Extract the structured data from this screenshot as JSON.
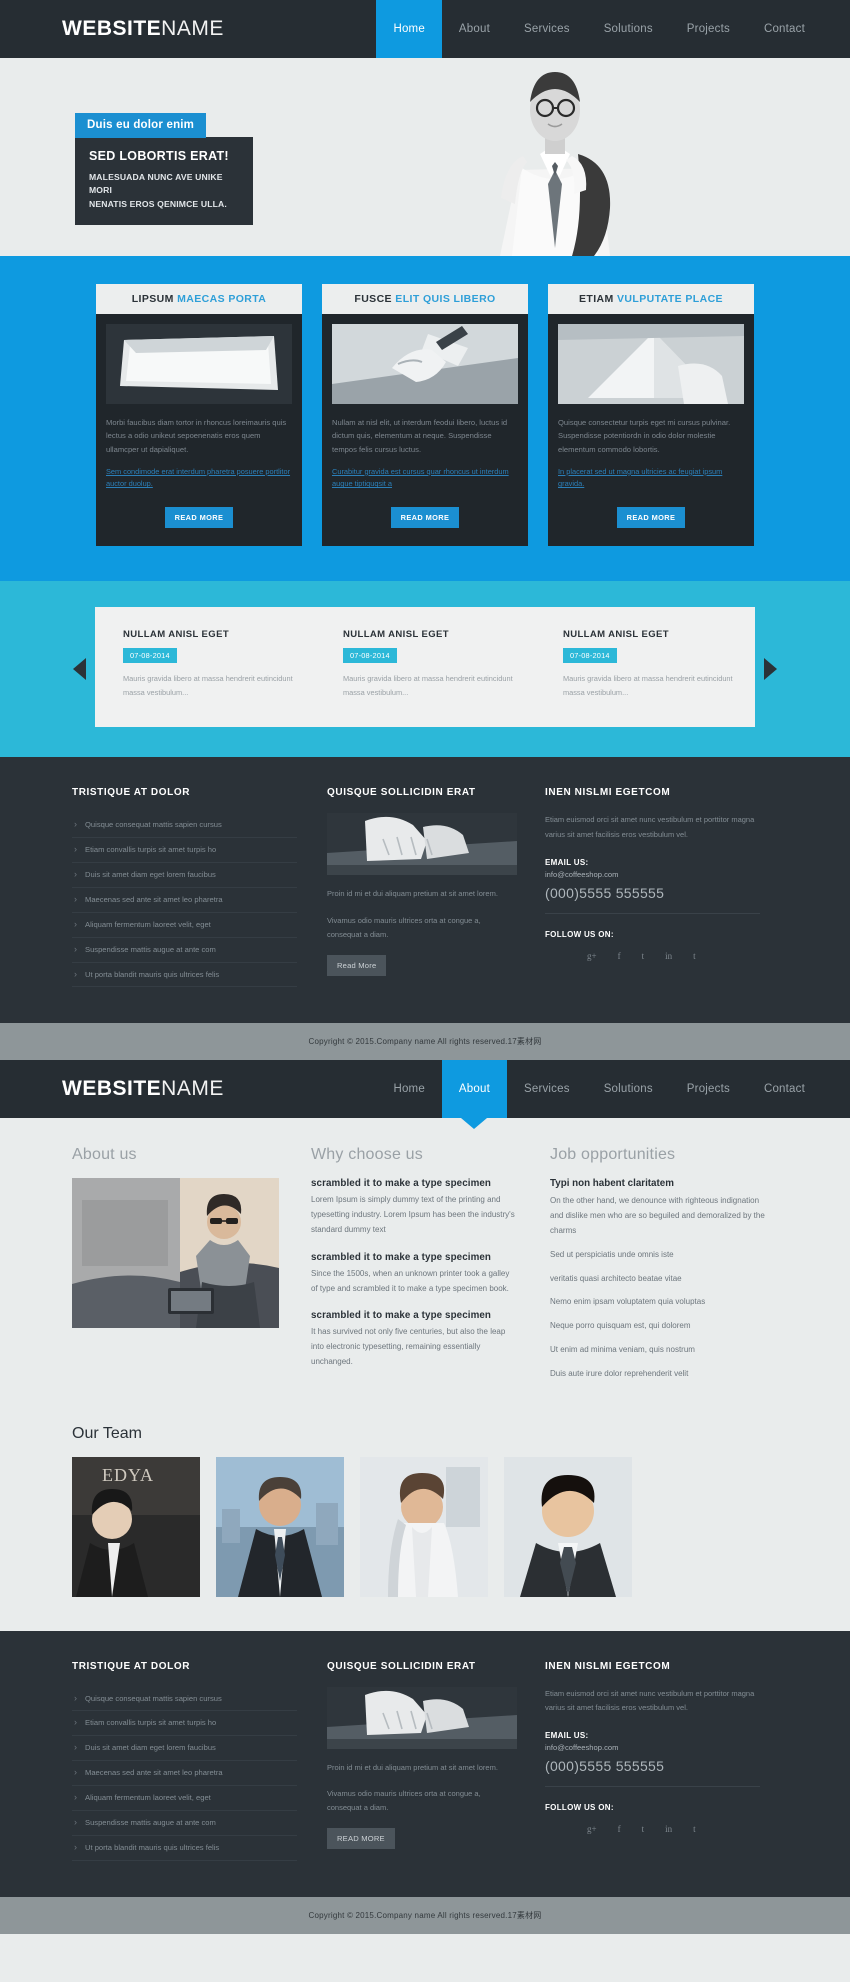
{
  "brand": {
    "bold": "WEBSITE",
    "light": "NAME"
  },
  "colors": {
    "accent": "#0e9ae0",
    "dark": "#2b3238",
    "teal": "#2cb8d8",
    "grey": "#8e9699"
  },
  "nav_home": [
    {
      "label": "Home",
      "active": true
    },
    {
      "label": "About",
      "active": false
    },
    {
      "label": "Services",
      "active": false
    },
    {
      "label": "Solutions",
      "active": false
    },
    {
      "label": "Projects",
      "active": false
    },
    {
      "label": "Contact",
      "active": false
    }
  ],
  "nav_about": [
    {
      "label": "Home",
      "active": false
    },
    {
      "label": "About",
      "active": true
    },
    {
      "label": "Services",
      "active": false
    },
    {
      "label": "Solutions",
      "active": false
    },
    {
      "label": "Projects",
      "active": false
    },
    {
      "label": "Contact",
      "active": false
    }
  ],
  "hero": {
    "tag": "Duis eu dolor enim",
    "title": "SED LOBORTIS ERAT!",
    "line1": "MALESUADA NUNC AVE UNIKE MORI",
    "line2": "NENATIS EROS QENIMCE ULLA."
  },
  "services": [
    {
      "head_dark": "LIPSUM",
      "head_blue": "MAECAS PORTA",
      "text": "Morbi faucibus diam tortor in rhoncus loreimauris quis lectus a odio unikeut sepoenenatis eros quem ullamcper ut dapialiquet.",
      "link": "Sem condimode erat interdum pharetra posuere portlitor auctor duolup.",
      "button": "READ MORE"
    },
    {
      "head_dark": "FUSCE",
      "head_blue": "ELIT QUIS LIBERO",
      "text": "Nullam at nisl elit, ut interdum feodui libero, luctus id dictum quis, elementum at neque. Suspendisse tempos felis cursus luctus.",
      "link": "Curabitur gravida est cursus quar rhoncus ut interdum augue tiptiquqsit a",
      "button": "READ MORE"
    },
    {
      "head_dark": "ETIAM",
      "head_blue": "VULPUTATE PLACE",
      "text": "Quisque consectetur turpis eget mi cursus pulvinar. Suspendisse potentiordn in odio dolor molestie elementum commodo lobortis.",
      "link": "In placerat sed ut magna ultricies ac feugiat ipsum gravida.",
      "button": "READ MORE"
    }
  ],
  "news": [
    {
      "title": "NULLAM ANISL EGET",
      "date": "07-08-2014",
      "text": "Mauris gravida libero at massa hendrerit eutincidunt massa vestibulum..."
    },
    {
      "title": "NULLAM ANISL EGET",
      "date": "07-08-2014",
      "text": "Mauris gravida libero at massa hendrerit eutincidunt massa vestibulum..."
    },
    {
      "title": "NULLAM ANISL EGET",
      "date": "07-08-2014",
      "text": "Mauris gravida libero at massa hendrerit eutincidunt massa vestibulum..."
    }
  ],
  "footer": {
    "col1_title": "TRISTIQUE AT DOLOR",
    "links": [
      "Quisque consequat mattis sapien cursus",
      "Etiam convallis turpis sit amet turpis ho",
      "Duis sit amet diam eget lorem faucibus",
      "Maecenas sed ante sit amet leo pharetra",
      "Aliquam fermentum laoreet velit, eget",
      "Suspendisse mattis augue at ante com",
      "Ut porta blandit mauris quis ultrices felis"
    ],
    "col2_title": "QUISQUE SOLLICIDIN ERAT",
    "col2_p1": "Proin id mi et dui aliquam pretium at sit amet lorem.",
    "col2_p2": "Vivamus odio mauris ultrices orta at congue a, consequat a diam.",
    "col2_button": "Read More",
    "col2_button_alt": "READ MORE",
    "col3_title": "INEN NISLMI EGETCOM",
    "col3_intro": "Etiam euismod orci sit amet nunc vestibulum et porttitor magna varius sit amet facilisis eros vestibulum vel.",
    "email_label": "EMAIL US:",
    "email": "info@coffeeshop.com",
    "phone": "(000)5555 555555",
    "follow_label": "FOLLOW US ON:",
    "social": [
      "g+",
      "f",
      "t",
      "in",
      "t"
    ]
  },
  "copyright": "Copyright © 2015.Company name All rights reserved.17素材网",
  "about": {
    "col1_title": "About us",
    "col2_title": "Why choose us",
    "col3_title": "Job opportunities",
    "why_blocks": [
      {
        "heading": "scrambled it to make a type specimen",
        "text": "Lorem Ipsum is simply dummy text of the printing and typesetting industry. Lorem Ipsum has been the industry's standard dummy text"
      },
      {
        "heading": "scrambled it to make a type specimen",
        "text": "Since the 1500s, when an unknown printer took a galley of type and scrambled it to make a type specimen book."
      },
      {
        "heading": "scrambled it to make a type specimen",
        "text": "It has survived not only five centuries, but also the leap into electronic typesetting, remaining essentially unchanged."
      }
    ],
    "job_heading": "Typi non habent claritatem",
    "job_paragraphs": [
      "On the other hand, we denounce with righteous indignation and dislike men who are so beguiled and demoralized by the charms",
      "Sed ut perspiciatis unde omnis iste",
      "veritatis quasi architecto beatae vitae",
      "Nemo enim ipsam voluptatem quia voluptas",
      "Neque porro quisquam est, qui dolorem",
      "Ut enim ad minima veniam, quis nostrum",
      "Duis aute irure dolor reprehenderit velit"
    ],
    "team_title": "Our Team"
  }
}
